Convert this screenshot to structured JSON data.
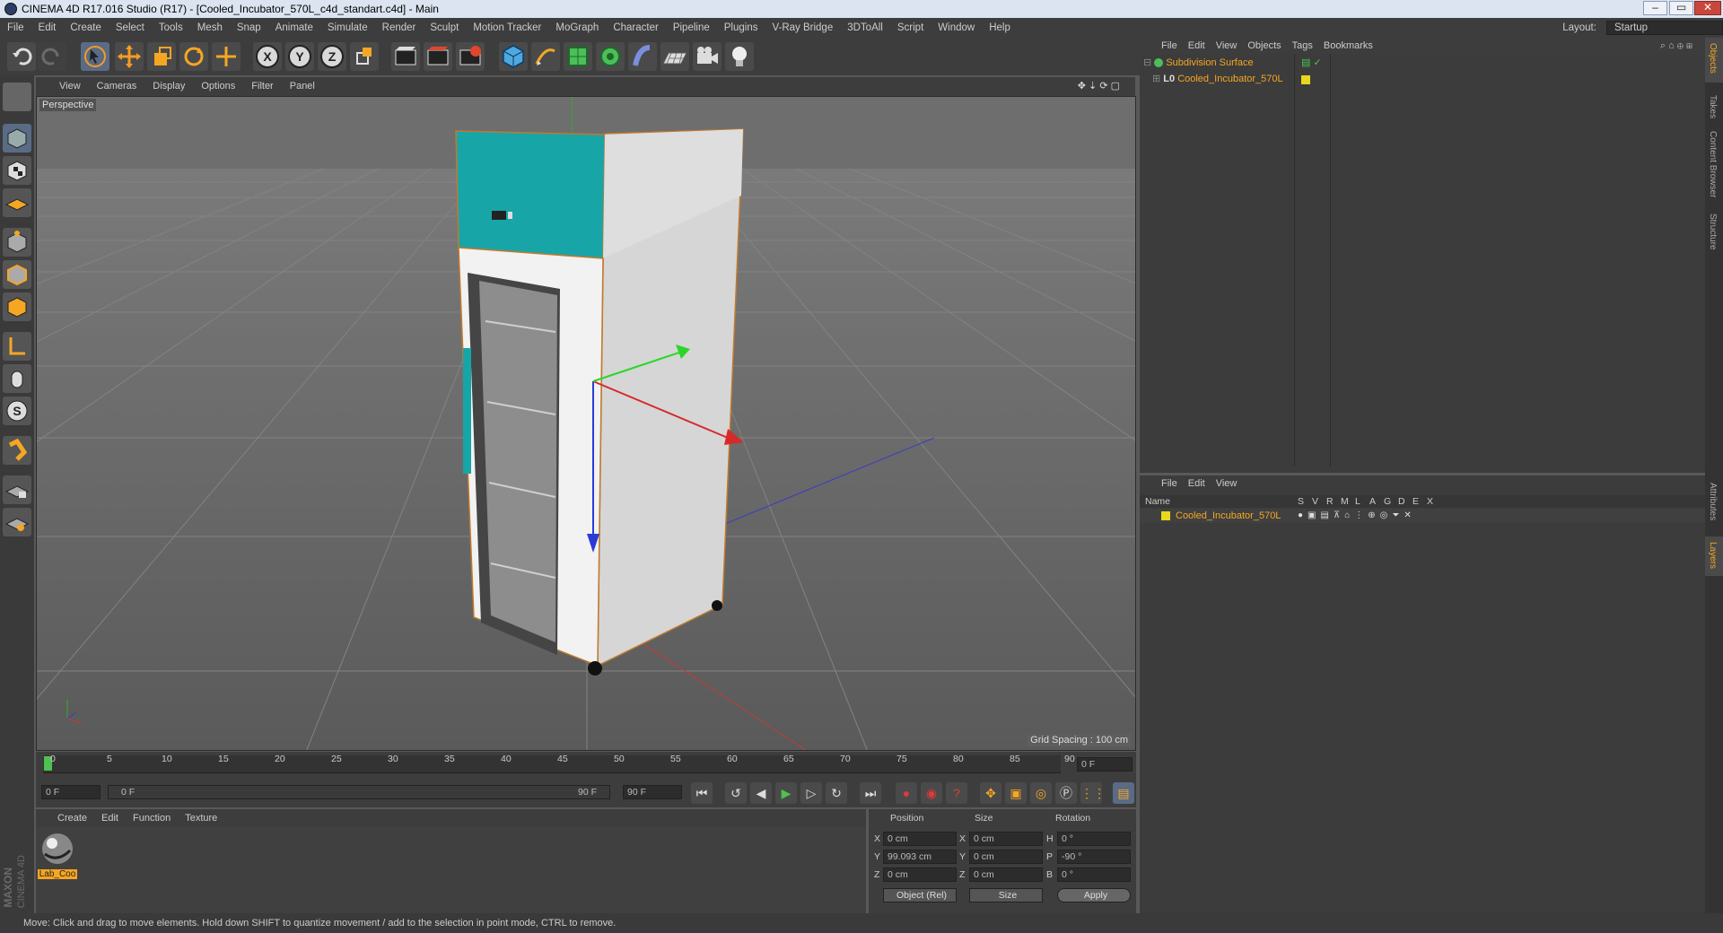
{
  "title": "CINEMA 4D R17.016 Studio (R17) - [Cooled_Incubator_570L_c4d_standart.c4d] - Main",
  "menu": [
    "File",
    "Edit",
    "Create",
    "Select",
    "Tools",
    "Mesh",
    "Snap",
    "Animate",
    "Simulate",
    "Render",
    "Sculpt",
    "Motion Tracker",
    "MoGraph",
    "Character",
    "Pipeline",
    "Plugins",
    "V-Ray Bridge",
    "3DToAll",
    "Script",
    "Window",
    "Help"
  ],
  "layout": {
    "label": "Layout:",
    "value": "Startup"
  },
  "toolbar_axes": [
    "X",
    "Y",
    "Z"
  ],
  "viewport": {
    "menu": [
      "View",
      "Cameras",
      "Display",
      "Options",
      "Filter",
      "Panel"
    ],
    "label": "Perspective",
    "grid_spacing": "Grid Spacing : 100 cm"
  },
  "timeline": {
    "ticks": [
      "0",
      "5",
      "10",
      "15",
      "20",
      "25",
      "30",
      "35",
      "40",
      "45",
      "50",
      "55",
      "60",
      "65",
      "70",
      "75",
      "80",
      "85",
      "90"
    ],
    "current_frame": "0 F",
    "start_field": "0 F",
    "range_start": "0 F",
    "range_end": "90 F",
    "end_field": "90 F"
  },
  "material_panel": {
    "menu": [
      "Create",
      "Edit",
      "Function",
      "Texture"
    ],
    "material_name": "Lab_Coo"
  },
  "coords": {
    "headers": [
      "Position",
      "Size",
      "Rotation"
    ],
    "rows": [
      {
        "axis": "X",
        "pos": "0 cm",
        "saxis": "X",
        "size": "0 cm",
        "raxis": "H",
        "rot": "0 °"
      },
      {
        "axis": "Y",
        "pos": "99.093 cm",
        "saxis": "Y",
        "size": "0 cm",
        "raxis": "P",
        "rot": "-90 °"
      },
      {
        "axis": "Z",
        "pos": "0 cm",
        "saxis": "Z",
        "size": "0 cm",
        "raxis": "B",
        "rot": "0 °"
      }
    ],
    "mode": "Object (Rel)",
    "size_mode": "Size",
    "apply": "Apply"
  },
  "objects_panel": {
    "menu": [
      "File",
      "Edit",
      "View",
      "Objects",
      "Tags",
      "Bookmarks"
    ],
    "items": [
      {
        "name": "Subdivision Surface"
      },
      {
        "name": "Cooled_Incubator_570L"
      }
    ]
  },
  "layers_panel": {
    "menu": [
      "File",
      "Edit",
      "View"
    ],
    "columns": [
      "Name",
      "S",
      "V",
      "R",
      "M",
      "L",
      "A",
      "G",
      "D",
      "E",
      "X"
    ],
    "items": [
      {
        "name": "Cooled_Incubator_570L"
      }
    ]
  },
  "side_tabs": [
    "Objects",
    "Takes",
    "Content Browser",
    "Structure",
    "Attributes",
    "Layers"
  ],
  "maxon": {
    "line1": "MAXON",
    "line2": "CINEMA 4D"
  },
  "status": "Move: Click and drag to move elements. Hold down SHIFT to quantize movement / add to the selection in point mode, CTRL to remove.",
  "colors": {
    "accent_orange": "#f5a623",
    "teal": "#18a5a8",
    "selected_blue": "#3e5d85"
  }
}
